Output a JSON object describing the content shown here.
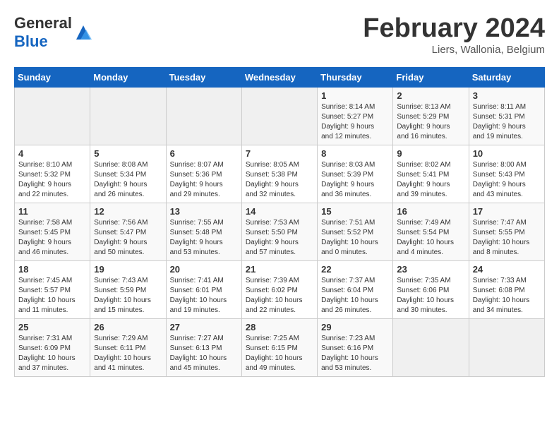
{
  "header": {
    "logo_general": "General",
    "logo_blue": "Blue",
    "month": "February 2024",
    "location": "Liers, Wallonia, Belgium"
  },
  "days_of_week": [
    "Sunday",
    "Monday",
    "Tuesday",
    "Wednesday",
    "Thursday",
    "Friday",
    "Saturday"
  ],
  "weeks": [
    [
      {
        "day": "",
        "info": ""
      },
      {
        "day": "",
        "info": ""
      },
      {
        "day": "",
        "info": ""
      },
      {
        "day": "",
        "info": ""
      },
      {
        "day": "1",
        "info": "Sunrise: 8:14 AM\nSunset: 5:27 PM\nDaylight: 9 hours\nand 12 minutes."
      },
      {
        "day": "2",
        "info": "Sunrise: 8:13 AM\nSunset: 5:29 PM\nDaylight: 9 hours\nand 16 minutes."
      },
      {
        "day": "3",
        "info": "Sunrise: 8:11 AM\nSunset: 5:31 PM\nDaylight: 9 hours\nand 19 minutes."
      }
    ],
    [
      {
        "day": "4",
        "info": "Sunrise: 8:10 AM\nSunset: 5:32 PM\nDaylight: 9 hours\nand 22 minutes."
      },
      {
        "day": "5",
        "info": "Sunrise: 8:08 AM\nSunset: 5:34 PM\nDaylight: 9 hours\nand 26 minutes."
      },
      {
        "day": "6",
        "info": "Sunrise: 8:07 AM\nSunset: 5:36 PM\nDaylight: 9 hours\nand 29 minutes."
      },
      {
        "day": "7",
        "info": "Sunrise: 8:05 AM\nSunset: 5:38 PM\nDaylight: 9 hours\nand 32 minutes."
      },
      {
        "day": "8",
        "info": "Sunrise: 8:03 AM\nSunset: 5:39 PM\nDaylight: 9 hours\nand 36 minutes."
      },
      {
        "day": "9",
        "info": "Sunrise: 8:02 AM\nSunset: 5:41 PM\nDaylight: 9 hours\nand 39 minutes."
      },
      {
        "day": "10",
        "info": "Sunrise: 8:00 AM\nSunset: 5:43 PM\nDaylight: 9 hours\nand 43 minutes."
      }
    ],
    [
      {
        "day": "11",
        "info": "Sunrise: 7:58 AM\nSunset: 5:45 PM\nDaylight: 9 hours\nand 46 minutes."
      },
      {
        "day": "12",
        "info": "Sunrise: 7:56 AM\nSunset: 5:47 PM\nDaylight: 9 hours\nand 50 minutes."
      },
      {
        "day": "13",
        "info": "Sunrise: 7:55 AM\nSunset: 5:48 PM\nDaylight: 9 hours\nand 53 minutes."
      },
      {
        "day": "14",
        "info": "Sunrise: 7:53 AM\nSunset: 5:50 PM\nDaylight: 9 hours\nand 57 minutes."
      },
      {
        "day": "15",
        "info": "Sunrise: 7:51 AM\nSunset: 5:52 PM\nDaylight: 10 hours\nand 0 minutes."
      },
      {
        "day": "16",
        "info": "Sunrise: 7:49 AM\nSunset: 5:54 PM\nDaylight: 10 hours\nand 4 minutes."
      },
      {
        "day": "17",
        "info": "Sunrise: 7:47 AM\nSunset: 5:55 PM\nDaylight: 10 hours\nand 8 minutes."
      }
    ],
    [
      {
        "day": "18",
        "info": "Sunrise: 7:45 AM\nSunset: 5:57 PM\nDaylight: 10 hours\nand 11 minutes."
      },
      {
        "day": "19",
        "info": "Sunrise: 7:43 AM\nSunset: 5:59 PM\nDaylight: 10 hours\nand 15 minutes."
      },
      {
        "day": "20",
        "info": "Sunrise: 7:41 AM\nSunset: 6:01 PM\nDaylight: 10 hours\nand 19 minutes."
      },
      {
        "day": "21",
        "info": "Sunrise: 7:39 AM\nSunset: 6:02 PM\nDaylight: 10 hours\nand 22 minutes."
      },
      {
        "day": "22",
        "info": "Sunrise: 7:37 AM\nSunset: 6:04 PM\nDaylight: 10 hours\nand 26 minutes."
      },
      {
        "day": "23",
        "info": "Sunrise: 7:35 AM\nSunset: 6:06 PM\nDaylight: 10 hours\nand 30 minutes."
      },
      {
        "day": "24",
        "info": "Sunrise: 7:33 AM\nSunset: 6:08 PM\nDaylight: 10 hours\nand 34 minutes."
      }
    ],
    [
      {
        "day": "25",
        "info": "Sunrise: 7:31 AM\nSunset: 6:09 PM\nDaylight: 10 hours\nand 37 minutes."
      },
      {
        "day": "26",
        "info": "Sunrise: 7:29 AM\nSunset: 6:11 PM\nDaylight: 10 hours\nand 41 minutes."
      },
      {
        "day": "27",
        "info": "Sunrise: 7:27 AM\nSunset: 6:13 PM\nDaylight: 10 hours\nand 45 minutes."
      },
      {
        "day": "28",
        "info": "Sunrise: 7:25 AM\nSunset: 6:15 PM\nDaylight: 10 hours\nand 49 minutes."
      },
      {
        "day": "29",
        "info": "Sunrise: 7:23 AM\nSunset: 6:16 PM\nDaylight: 10 hours\nand 53 minutes."
      },
      {
        "day": "",
        "info": ""
      },
      {
        "day": "",
        "info": ""
      }
    ]
  ]
}
